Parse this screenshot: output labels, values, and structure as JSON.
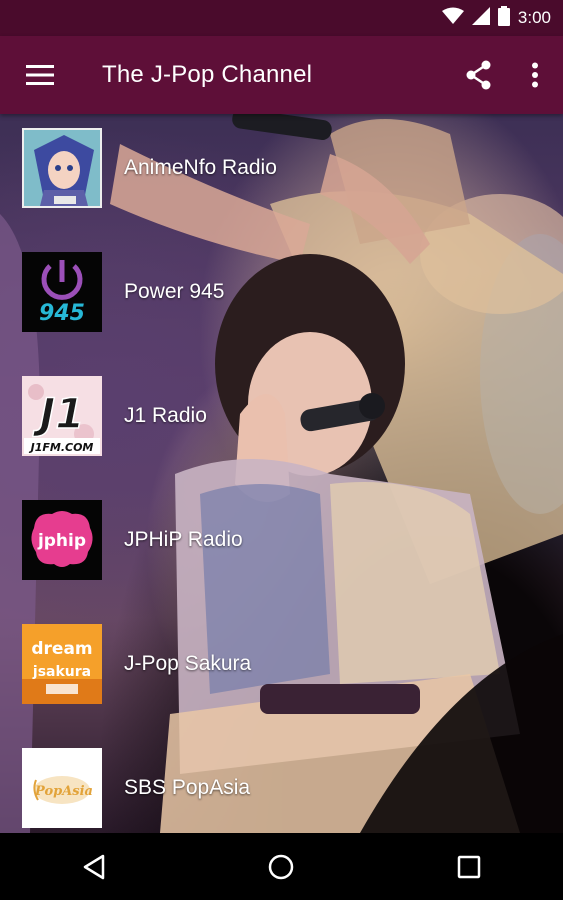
{
  "status_bar": {
    "time": "3:00",
    "icons": [
      "wifi-icon",
      "signal-icon",
      "battery-icon"
    ]
  },
  "app_bar": {
    "title": "The J-Pop Channel",
    "background_color": "#5e0f38",
    "status_color": "#4a0b2c",
    "actions": [
      "menu-icon",
      "share-icon",
      "more-vert-icon"
    ]
  },
  "stations": [
    {
      "name": "AnimeNfo Radio",
      "logo": "animenfo-logo"
    },
    {
      "name": "Power 945",
      "logo": "power945-logo",
      "logo_text": "945"
    },
    {
      "name": "J1 Radio",
      "logo": "j1-logo",
      "logo_text": "J1",
      "logo_subtext": "J1FM.COM"
    },
    {
      "name": "JPHiP Radio",
      "logo": "jphip-logo",
      "logo_text": "jphip"
    },
    {
      "name": "J-Pop Sakura",
      "logo": "jpop-sakura-logo",
      "logo_text": "dream",
      "logo_subtext": "jsakura"
    },
    {
      "name": "SBS PopAsia",
      "logo": "sbs-popasia-logo",
      "logo_text": "PopAsia"
    }
  ],
  "nav_bar": {
    "buttons": [
      "back-icon",
      "home-icon",
      "recents-icon"
    ]
  }
}
